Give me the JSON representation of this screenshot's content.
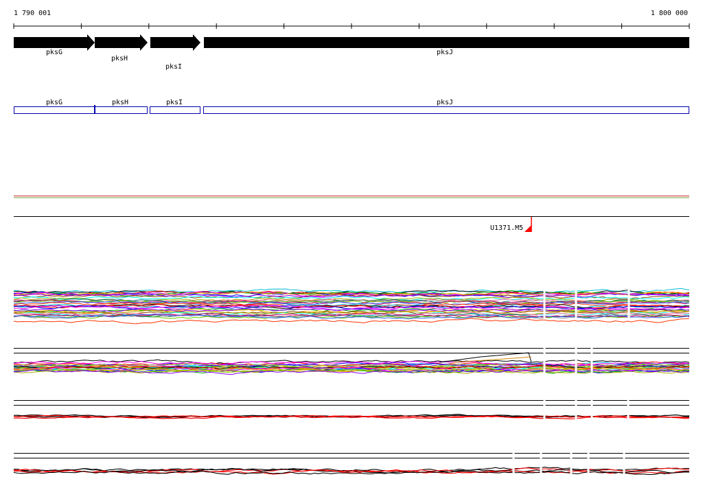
{
  "ruler": {
    "start_label": "1 790 001",
    "end_label": "1 800 000"
  },
  "gene_track": {
    "genes": [
      {
        "name": "pksG"
      },
      {
        "name": "pksH"
      },
      {
        "name": "pksI"
      },
      {
        "name": "pksJ"
      }
    ]
  },
  "cds_track": {
    "genes": [
      {
        "name": "pksG"
      },
      {
        "name": "pksH"
      },
      {
        "name": "pksI"
      },
      {
        "name": "pksJ"
      }
    ],
    "color": "#0000aa"
  },
  "marker": {
    "label": "U1371.M5",
    "color": "#ff0000"
  },
  "colors": {
    "line_track_1": "#cc3333",
    "line_track_2": "#779933"
  }
}
